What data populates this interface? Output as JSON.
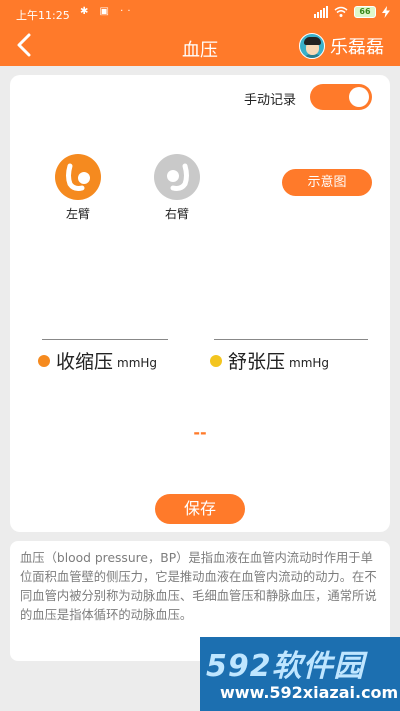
{
  "status_bar": {
    "time": "上午11:25",
    "icons": "✱ ▣ ··",
    "battery": "66"
  },
  "header": {
    "back_icon": "chevron-left-icon",
    "title": "血压",
    "username": "乐磊磊"
  },
  "card": {
    "manual_label": "手动记录",
    "toggle_on": true,
    "left_arm_label": "左臂",
    "right_arm_label": "右臂",
    "selected_arm": "left",
    "diagram_button": "示意图",
    "systolic_label": "收缩压",
    "diastolic_label": "舒张压",
    "unit": "mmHg",
    "reading": "--",
    "save_button": "保存"
  },
  "description": "血压（blood pressure，BP）是指血液在血管内流动时作用于单位面积血管壁的侧压力，它是推动血液在血管内流动的动力。在不同血管内被分别称为动脉血压、毛细血管压和静脉血压，通常所说的血压是指体循环的动脉血压。",
  "watermark": {
    "brand": "592软件园",
    "url": "www.592xiazai.com"
  },
  "colors": {
    "accent": "#ff7a2a",
    "systolic_dot": "#f58a1f",
    "diastolic_dot": "#f3c51f",
    "watermark_bg": "#1c6fb0"
  }
}
